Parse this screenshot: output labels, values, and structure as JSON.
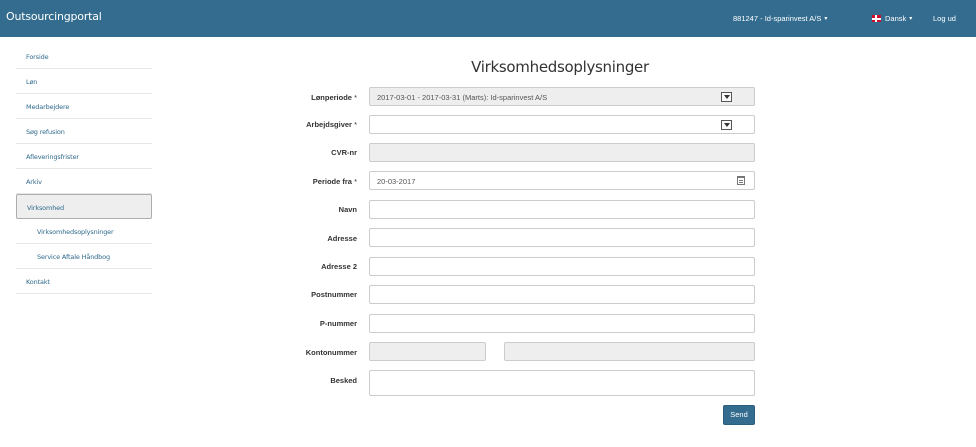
{
  "navbar": {
    "brand": "Outsourcingportal",
    "account": "881247 - Id-sparinvest A/S",
    "language": "Dansk",
    "logout": "Log ud"
  },
  "sidebar": {
    "items": [
      {
        "label": "Forside"
      },
      {
        "label": "Løn"
      },
      {
        "label": "Medarbejdere"
      },
      {
        "label": "Søg refusion"
      },
      {
        "label": "Afleveringsfrister"
      },
      {
        "label": "Arkiv"
      },
      {
        "label": "Virksomhed",
        "active": true
      },
      {
        "label": "Virksomhedsoplysninger",
        "sub": true
      },
      {
        "label": "Service Aftale Håndbog",
        "sub": true
      },
      {
        "label": "Kontakt"
      }
    ]
  },
  "form": {
    "title": "Virksomhedsoplysninger",
    "lonperiode": {
      "label": "Lønperiode",
      "value": "2017-03-01 - 2017-03-31 (Marts): Id-sparinvest A/S"
    },
    "arbejdsgiver": {
      "label": "Arbejdsgiver",
      "value": ""
    },
    "cvr": {
      "label": "CVR-nr",
      "value": ""
    },
    "periode_fra": {
      "label": "Periode fra",
      "value": "20-03-2017"
    },
    "navn": {
      "label": "Navn",
      "value": ""
    },
    "adresse": {
      "label": "Adresse",
      "value": ""
    },
    "adresse2": {
      "label": "Adresse 2",
      "value": ""
    },
    "postnummer": {
      "label": "Postnummer",
      "value": ""
    },
    "pnummer": {
      "label": "P-nummer",
      "value": ""
    },
    "kontonummer": {
      "label": "Kontonummer",
      "value_reg": "",
      "value_konto": ""
    },
    "besked": {
      "label": "Besked",
      "value": ""
    },
    "required_marker": "*",
    "send": "Send"
  },
  "colors": {
    "navbar": "#336c8e",
    "link": "#2f6a8c",
    "disabled_field": "#eeeeee"
  },
  "icons": [
    "chevron-down-icon",
    "calendar-icon",
    "denmark-flag-icon"
  ]
}
